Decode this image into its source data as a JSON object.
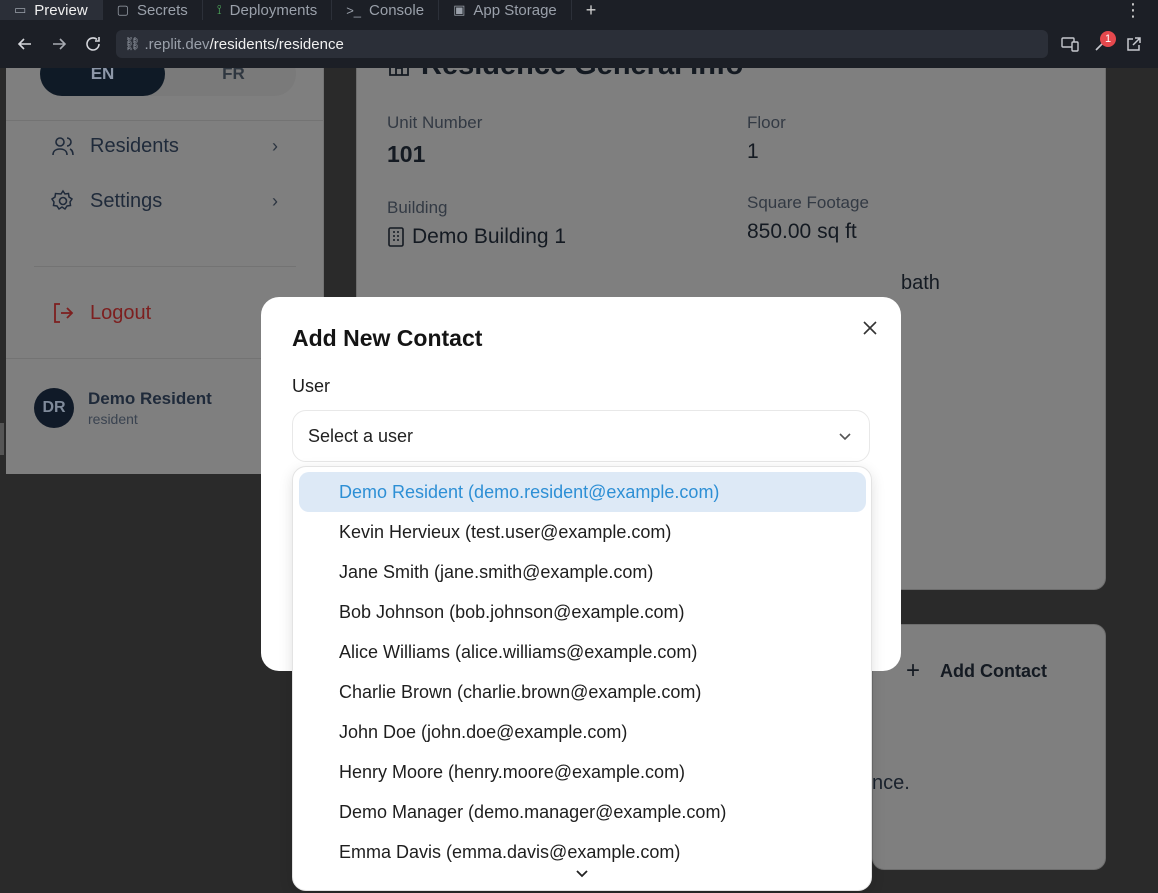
{
  "chrome": {
    "tabs": [
      {
        "label": "Preview",
        "icon": "monitor-icon"
      },
      {
        "label": "Secrets",
        "icon": "lock-icon"
      },
      {
        "label": "Deployments",
        "icon": "deploy-icon"
      },
      {
        "label": "Console",
        "icon": "terminal-icon"
      },
      {
        "label": "App Storage",
        "icon": "storage-icon"
      }
    ],
    "url_host": ".replit.dev",
    "url_path": "/residents/residence",
    "badge_count": "1"
  },
  "sidebar": {
    "lang_en": "EN",
    "lang_fr": "FR",
    "nav": [
      {
        "label": "Residents"
      },
      {
        "label": "Settings"
      }
    ],
    "logout": "Logout",
    "user": {
      "initials": "DR",
      "name": "Demo Resident",
      "role": "resident"
    }
  },
  "residence": {
    "title": "Residence General Info",
    "unit_label": "Unit Number",
    "unit_value": "101",
    "floor_label": "Floor",
    "floor_value": "1",
    "building_label": "Building",
    "building_value": "Demo Building 1",
    "sqft_label": "Square Footage",
    "sqft_value": "850.00 sq ft",
    "peek_bath": "bath",
    "peek_nce": "nce.",
    "add_contact": "Add Contact"
  },
  "modal": {
    "title": "Add New Contact",
    "user_label": "User",
    "select_placeholder": "Select a user",
    "options": [
      "Demo Resident (demo.resident@example.com)",
      "Kevin Hervieux (test.user@example.com)",
      "Jane Smith (jane.smith@example.com)",
      "Bob Johnson (bob.johnson@example.com)",
      "Alice Williams (alice.williams@example.com)",
      "Charlie Brown (charlie.brown@example.com)",
      "John Doe (john.doe@example.com)",
      "Henry Moore (henry.moore@example.com)",
      "Demo Manager (demo.manager@example.com)",
      "Emma Davis (emma.davis@example.com)"
    ]
  },
  "colors": {
    "accent": "#2d8fd5",
    "highlight": "#dde9f6",
    "logout_red": "#7d1f1f"
  }
}
